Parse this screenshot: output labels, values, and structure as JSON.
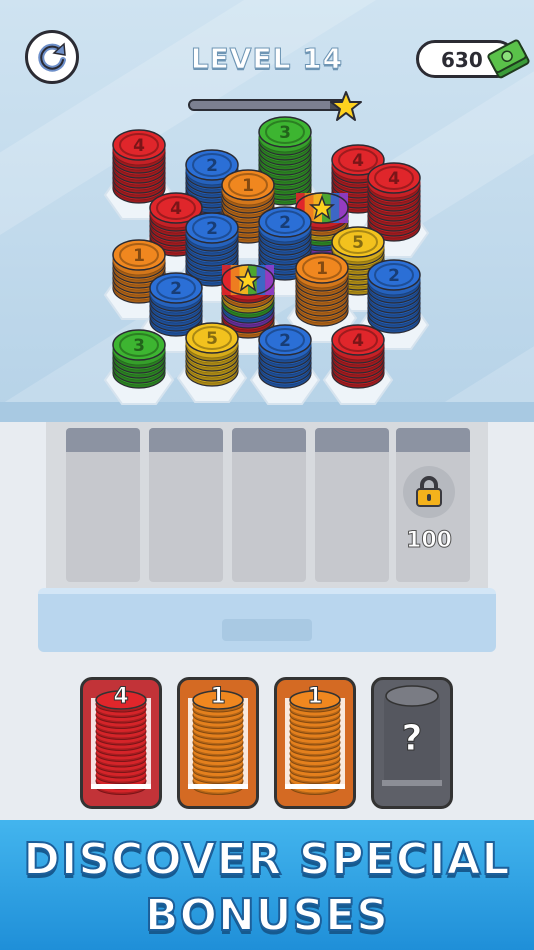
{
  "header": {
    "level_label": "LEVEL 14",
    "cash": "630",
    "level_progress": 0.9
  },
  "icons": {
    "restart": "restart-icon",
    "cash": "cash-icon",
    "progress_star": "star-icon",
    "lock": "padlock-icon"
  },
  "board": {
    "stacks": [
      {
        "color": "#e0262b",
        "number": "4"
      },
      {
        "color": "#2b6fd6",
        "number": "2"
      },
      {
        "color": "#3db531",
        "number": "3"
      },
      {
        "color": "#e0262b",
        "number": "4"
      },
      {
        "color": "#e0262b",
        "number": "4"
      },
      {
        "color": "#e0262b",
        "number": "4"
      },
      {
        "color": "#f0871f",
        "number": "1"
      },
      {
        "color": "#2b6fd6",
        "number": "2"
      },
      {
        "color": "rainbow",
        "number": "star"
      },
      {
        "color": "#2b6fd6",
        "number": "2"
      },
      {
        "color": "#f0871f",
        "number": "1"
      },
      {
        "color": "#f2c21e",
        "number": "5"
      },
      {
        "color": "#2b6fd6",
        "number": "2"
      },
      {
        "color": "rainbow",
        "number": "star"
      },
      {
        "color": "#f0871f",
        "number": "1"
      },
      {
        "color": "#2b6fd6",
        "number": "2"
      },
      {
        "color": "#3db531",
        "number": "3"
      },
      {
        "color": "#f2c21e",
        "number": "5"
      },
      {
        "color": "#2b6fd6",
        "number": "2"
      },
      {
        "color": "#e0262b",
        "number": "4"
      }
    ]
  },
  "tray": {
    "slot_count": 5,
    "locked_slot_price": "100"
  },
  "spawn_stacks": [
    {
      "number": "4",
      "color": "#e0262b",
      "frame": "#c23338",
      "state": "ready"
    },
    {
      "number": "1",
      "color": "#f0871f",
      "frame": "#d46a23",
      "state": "ready"
    },
    {
      "number": "1",
      "color": "#f0871f",
      "frame": "#d46a23",
      "state": "ready"
    },
    {
      "number": "?",
      "color": "#6e7078",
      "frame": "#5e6068",
      "state": "hidden"
    }
  ],
  "banner": {
    "line1": "DISCOVER SPECIAL",
    "line2": "BONUSES"
  }
}
